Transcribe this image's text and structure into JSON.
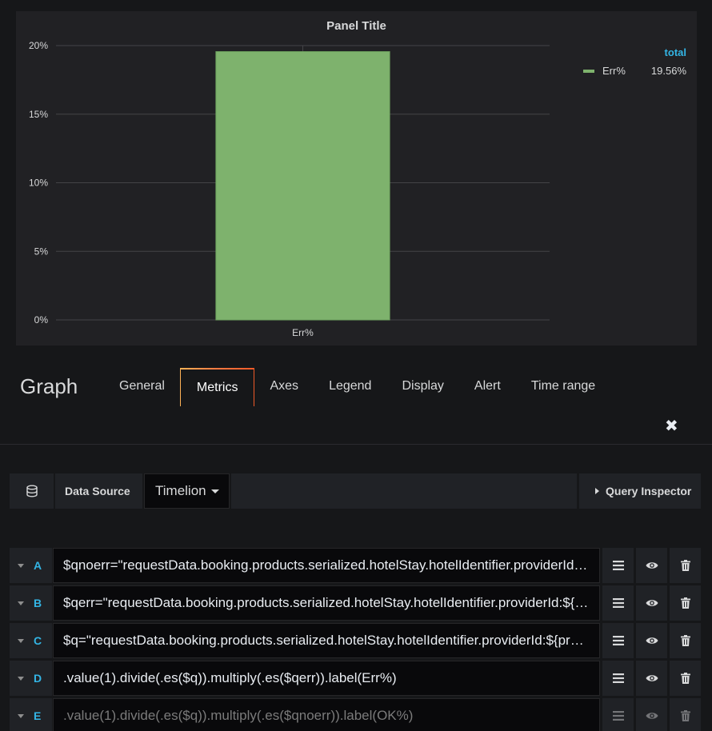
{
  "panel": {
    "title": "Panel Title",
    "legend": {
      "header": "total",
      "items": [
        {
          "name": "Err%",
          "value": "19.56%",
          "color": "#7eb26d"
        }
      ]
    }
  },
  "chart_data": {
    "type": "bar",
    "title": "Panel Title",
    "categories": [
      "Err%"
    ],
    "series": [
      {
        "name": "Err%",
        "values": [
          19.56
        ]
      }
    ],
    "yticks": [
      "0%",
      "5%",
      "10%",
      "15%",
      "20%"
    ],
    "ylim": [
      0,
      20
    ],
    "grid": true,
    "legend_position": "right",
    "bar_color": "#7eb26d"
  },
  "editor": {
    "title": "Graph",
    "tabs": [
      {
        "label": "General"
      },
      {
        "label": "Metrics",
        "active": true
      },
      {
        "label": "Axes"
      },
      {
        "label": "Legend"
      },
      {
        "label": "Display"
      },
      {
        "label": "Alert"
      },
      {
        "label": "Time range"
      }
    ],
    "close_glyph": "✖"
  },
  "datasource": {
    "label": "Data Source",
    "selected": "Timelion",
    "icon": "database-icon",
    "query_inspector": "Query Inspector"
  },
  "queries": [
    {
      "letter": "A",
      "text": "$qnoerr=\"requestData.booking.products.serialized.hotelStay.hotelIdentifier.providerId:${provider}\"",
      "disabled": false
    },
    {
      "letter": "B",
      "text": "$qerr=\"requestData.booking.products.serialized.hotelStay.hotelIdentifier.providerId:${provider}\"",
      "disabled": false
    },
    {
      "letter": "C",
      "text": "$q=\"requestData.booking.products.serialized.hotelStay.hotelIdentifier.providerId:${provider}\"",
      "disabled": false
    },
    {
      "letter": "D",
      "text": ".value(1).divide(.es($q)).multiply(.es($qerr)).label(Err%)",
      "disabled": false
    },
    {
      "letter": "E",
      "text": ".value(1).divide(.es($q)).multiply(.es($qnoerr)).label(OK%)",
      "disabled": true
    }
  ],
  "colors": {
    "accent": "#33b5e5",
    "background": "#161719",
    "panel": "#212124",
    "bar": "#7eb26d"
  }
}
